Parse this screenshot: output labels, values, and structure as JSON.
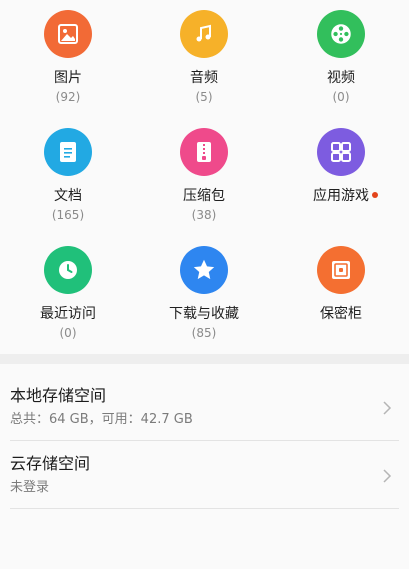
{
  "categories": [
    {
      "label": "图片",
      "count": "(92)",
      "icon": "image-icon",
      "color": "#f26a36"
    },
    {
      "label": "音频",
      "count": "(5)",
      "icon": "music-icon",
      "color": "#f6b129"
    },
    {
      "label": "视频",
      "count": "(0)",
      "icon": "video-reel-icon",
      "color": "#32bf5c"
    },
    {
      "label": "文档",
      "count": "(165)",
      "icon": "document-icon",
      "color": "#22a9e3"
    },
    {
      "label": "压缩包",
      "count": "(38)",
      "icon": "archive-icon",
      "color": "#ef4a8b"
    },
    {
      "label": "应用游戏",
      "count": "",
      "icon": "apps-icon",
      "color": "#7d5ce0",
      "badge": true
    },
    {
      "label": "最近访问",
      "count": "(0)",
      "icon": "clock-icon",
      "color": "#20c07a"
    },
    {
      "label": "下载与收藏",
      "count": "(85)",
      "icon": "star-icon",
      "color": "#2e86f0"
    },
    {
      "label": "保密柜",
      "count": "",
      "icon": "safe-icon",
      "color": "#f46f31"
    }
  ],
  "storage": {
    "local": {
      "title": "本地存储空间",
      "subtitle": "总共：64 GB，可用：42.7 GB"
    },
    "cloud": {
      "title": "云存储空间",
      "subtitle": "未登录"
    }
  }
}
